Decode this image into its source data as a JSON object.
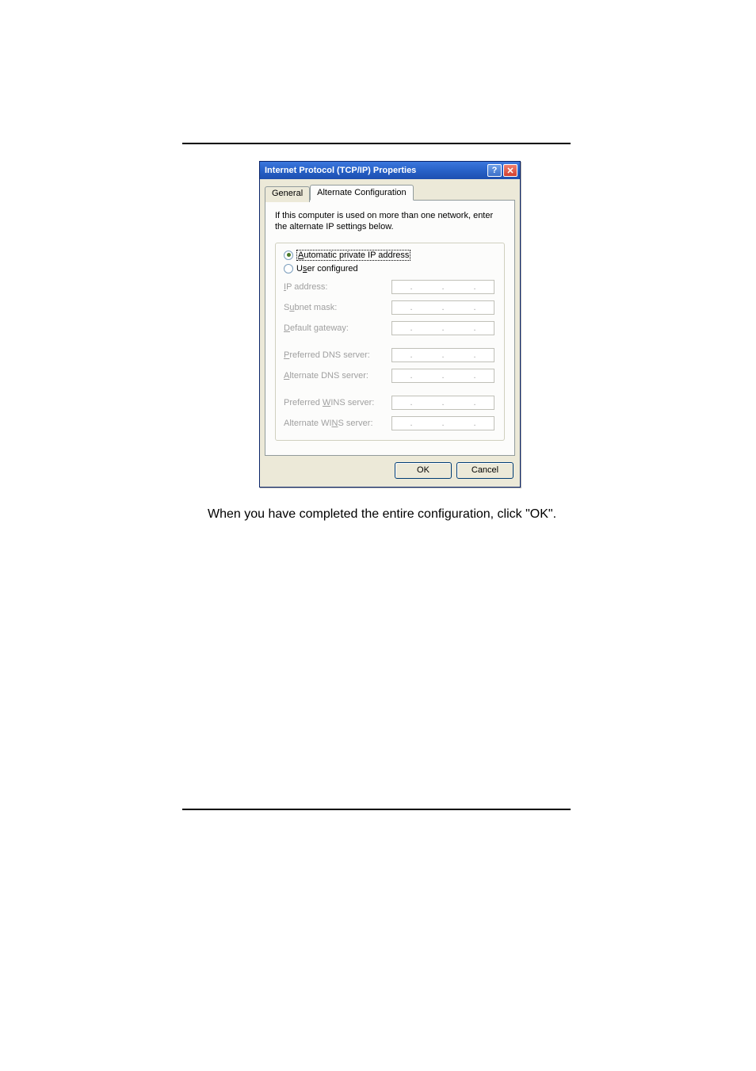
{
  "dialog": {
    "title": "Internet Protocol (TCP/IP) Properties",
    "tabs": {
      "general": "General",
      "alt": "Alternate Configuration"
    },
    "description": "If this computer is used on more than one network, enter the alternate IP settings below.",
    "radios": {
      "auto": "Automatic private IP address",
      "user": "User configured",
      "auto_ul": "A",
      "user_ul": "s"
    },
    "fields": {
      "ip": "IP address:",
      "subnet": "Subnet mask:",
      "gateway": "Default gateway:",
      "pref_dns": "Preferred DNS server:",
      "alt_dns": "Alternate DNS server:",
      "pref_wins": "Preferred WINS server:",
      "alt_wins": "Alternate WINS server:",
      "ip_ul": "I",
      "subnet_ul": "u",
      "gateway_ul": "D",
      "pref_dns_ul": "P",
      "alt_dns_ul": "A",
      "pref_wins_ul": "W",
      "alt_wins_ul": "N"
    },
    "buttons": {
      "ok": "OK",
      "cancel": "Cancel"
    }
  },
  "caption": "When you have completed the entire configuration, click \"OK\"."
}
